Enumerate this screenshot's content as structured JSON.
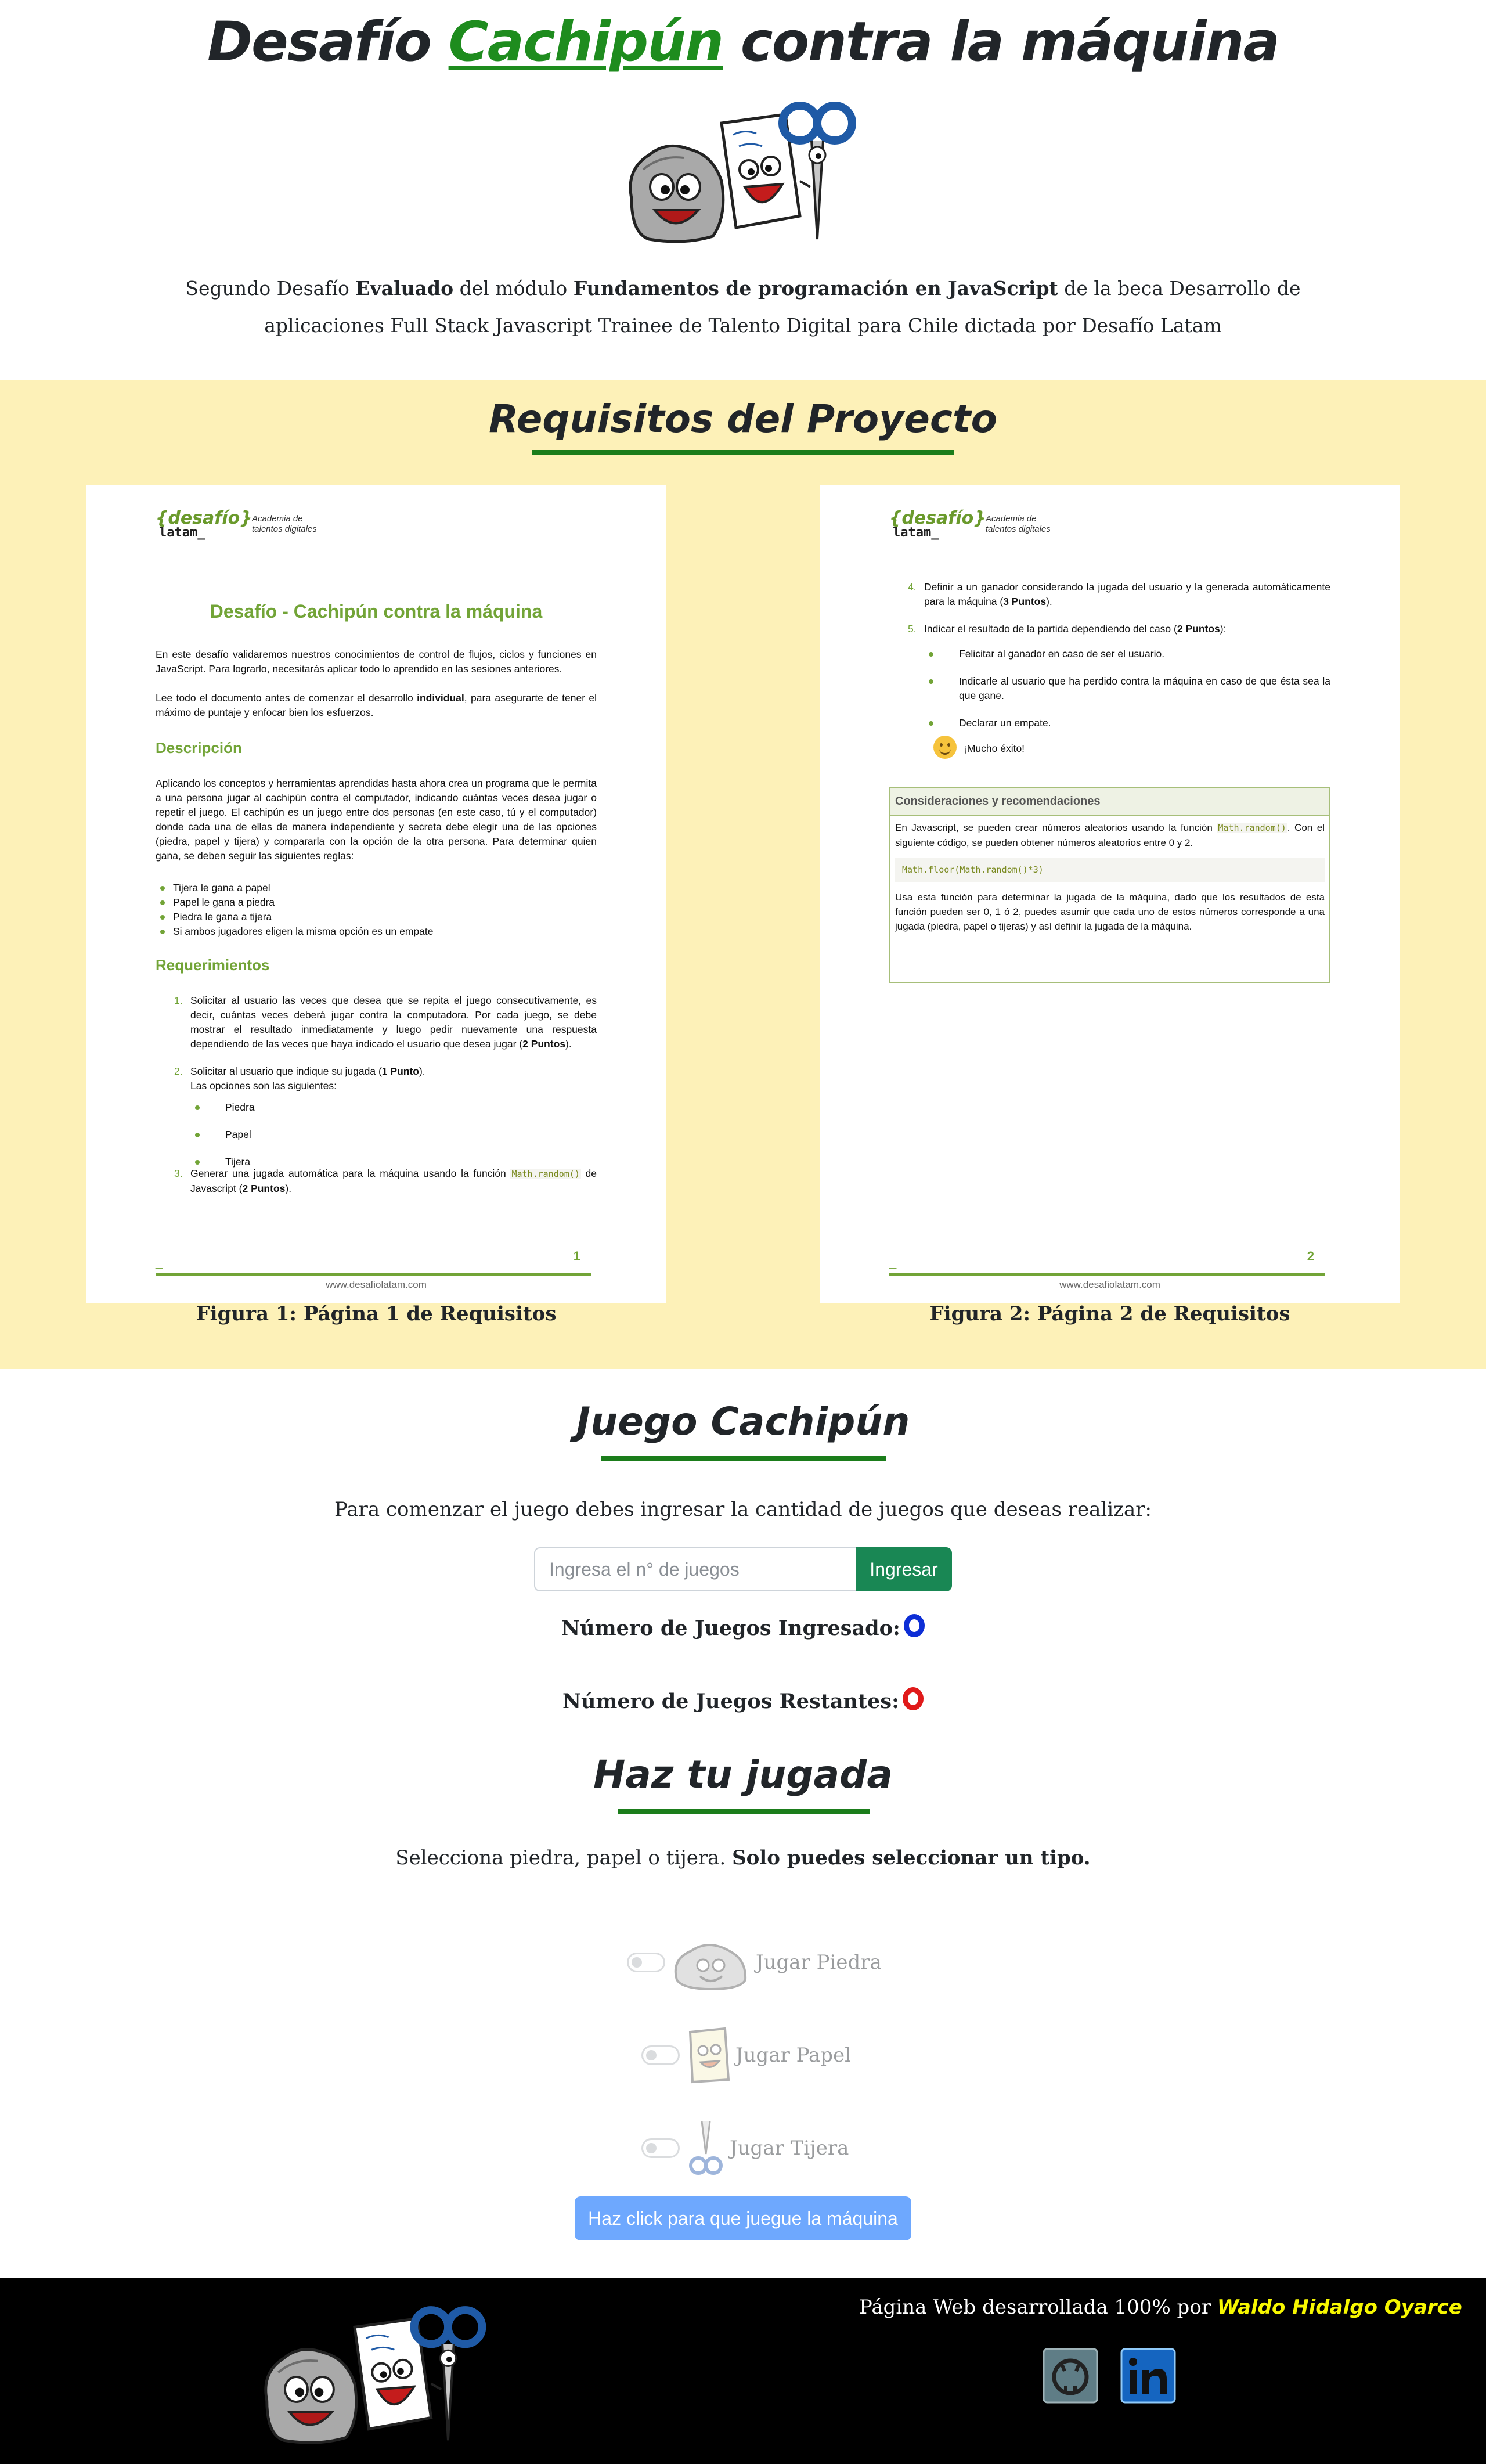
{
  "header": {
    "title_pre": "Desafío",
    "title_accent": "Cachipún",
    "title_post": "contra la máquina",
    "intro": {
      "t1": "Segundo Desafío ",
      "b1": "Evaluado",
      "t2": " del módulo ",
      "b2": "Fundamentos de programación en JavaScript",
      "t3": " de la beca Desarrollo de aplicaciones Full Stack Javascript Trainee de Talento Digital para Chile dictada por Desafío Latam"
    }
  },
  "requirements": {
    "title": "Requisitos del Proyecto",
    "caption1": "Figura 1: Página 1 de Requisitos",
    "caption2": "Figura 2: Página 2 de Requisitos",
    "logo": {
      "brand": "{desafío}",
      "brand2": "latam_",
      "tagline1": "Academia de",
      "tagline2": "talentos digitales"
    },
    "page1": {
      "title": "Desafío - Cachipún contra la máquina",
      "p1": "En este desafío validaremos nuestros conocimientos de control de flujos, ciclos y funciones en JavaScript. Para lograrlo, necesitarás aplicar todo lo aprendido en las sesiones anteriores.",
      "p2a": "Lee todo el documento antes de comenzar el desarrollo ",
      "p2b": "individual",
      "p2c": ", para asegurarte de tener el máximo de puntaje y enfocar bien los esfuerzos.",
      "h_desc": "Descripción",
      "desc": "Aplicando los conceptos y herramientas aprendidas hasta ahora crea un programa que le permita a una persona jugar al cachipún contra el computador, indicando cuántas veces desea jugar o repetir el juego. El cachipún es un juego entre dos personas (en este caso, tú y el computador) donde cada una de ellas de manera independiente y secreta debe elegir una de las opciones (piedra, papel y tijera) y compararla con la opción de la otra persona. Para determinar quien gana, se deben seguir las siguientes reglas:",
      "rules": [
        "Tijera le gana a papel",
        "Papel le gana a piedra",
        "Piedra le gana a tijera",
        "Si ambos jugadores eligen la misma opción es un empate"
      ],
      "h_req": "Requerimientos",
      "req1a": "Solicitar al usuario las veces que desea que se repita el juego consecutivamente, es decir, cuántas veces deberá jugar contra la computadora. Por cada juego, se debe mostrar el resultado inmediatamente y luego pedir nuevamente una respuesta dependiendo de las veces que haya indicado el usuario que desea jugar (",
      "req1b": "2 Puntos",
      "req1c": ").",
      "req2a": "Solicitar al usuario que indique su jugada (",
      "req2b": "1 Punto",
      "req2c": ").",
      "req2d": "Las opciones son las siguientes:",
      "options": [
        "Piedra",
        "Papel",
        "Tijera"
      ],
      "req3a": "Generar una jugada automática para la máquina usando la función ",
      "req3code": "Math.random()",
      "req3b": " de Javascript (",
      "req3c": "2 Puntos",
      "req3d": ").",
      "n1": "1.",
      "n2": "2.",
      "n3": "3.",
      "footdash": "_",
      "pagenum": "1",
      "url": "www.desafiolatam.com"
    },
    "page2": {
      "n4": "4.",
      "n5": "5.",
      "req4a": "Definir a un ganador considerando la jugada del usuario y la generada automáticamente para la máquina (",
      "req4b": "3 Puntos",
      "req4c": ").",
      "req5a": "Indicar el resultado de la partida dependiendo del caso (",
      "req5b": "2 Puntos",
      "req5c": "):",
      "results": [
        "Felicitar al ganador en caso de ser el usuario.",
        "Indicarle al usuario que ha perdido contra la máquina en caso de que ésta sea la que gane.",
        "Declarar un empate."
      ],
      "luck": "¡Mucho éxito!",
      "box_title": "Consideraciones y recomendaciones",
      "box_p1a": "En Javascript, se pueden crear números aleatorios usando la función ",
      "box_p1code": "Math.random()",
      "box_p1b": ". Con el siguiente código, se pueden obtener números aleatorios entre 0 y 2.",
      "box_code": "Math.floor(Math.random()*3)",
      "box_p2": "Usa esta función para determinar la jugada de la máquina, dado que los resultados de esta función pueden ser 0, 1 ó 2, puedes asumir que cada uno de estos números corresponde a una jugada (piedra, papel o tijeras) y así definir la jugada de la máquina.",
      "footdash": "_",
      "pagenum": "2",
      "url": "www.desafiolatam.com"
    }
  },
  "game": {
    "title": "Juego Cachipún",
    "intro": "Para comenzar el juego debes ingresar la cantidad de juegos que deseas realizar:",
    "input_placeholder": "Ingresa el n° de juegos",
    "submit_label": "Ingresar",
    "entered_label": "Número de Juegos Ingresado:",
    "remaining_label": "Número de Juegos Restantes:",
    "badge_blue": "#0d2ed6",
    "badge_red": "#e01a1a"
  },
  "play": {
    "title": "Haz tu jugada",
    "instruction": "Selecciona piedra, papel o tijera. ",
    "instruction_bold": "Solo puedes seleccionar un tipo.",
    "options": [
      {
        "label": "Jugar Piedra",
        "icon": "rock-icon"
      },
      {
        "label": "Jugar Papel",
        "icon": "paper-icon"
      },
      {
        "label": "Jugar Tijera",
        "icon": "scissors-icon"
      }
    ],
    "machine_button": "Haz click para que juegue la máquina"
  },
  "footer": {
    "credit": "Página Web desarrollada 100% por ",
    "author": "Waldo Hidalgo Oyarce",
    "social": [
      "github-icon",
      "linkedin-icon"
    ]
  },
  "colors": {
    "accent_green": "#1e8c1e",
    "requirements_bg": "#fdf1b8",
    "submit_green": "#198754",
    "machine_blue": "#6ea8fe",
    "author_yellow": "#f7f700"
  }
}
